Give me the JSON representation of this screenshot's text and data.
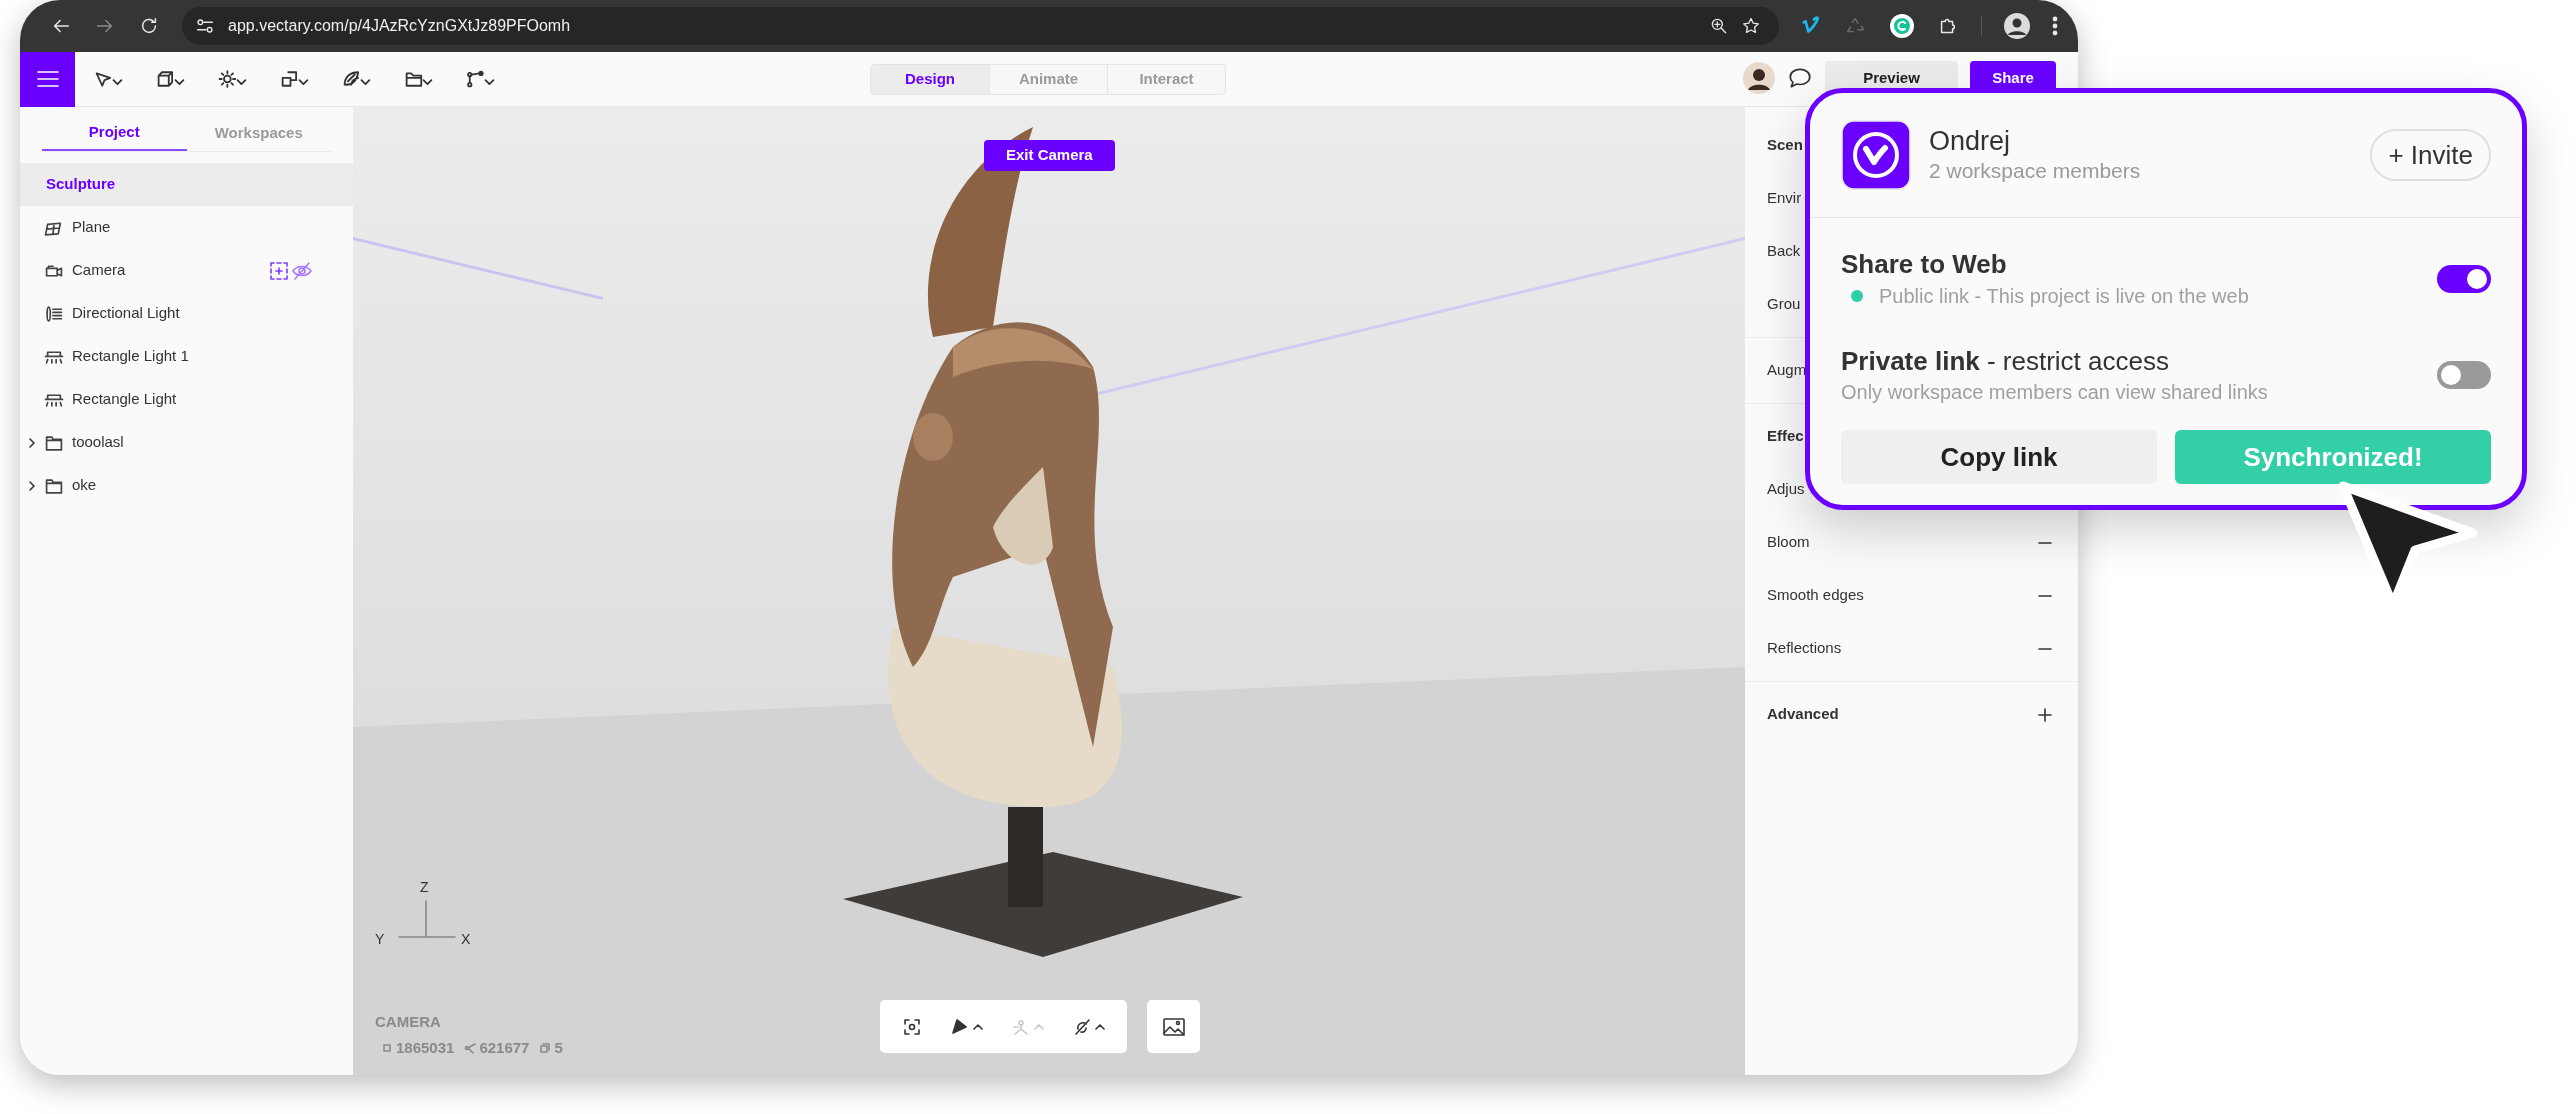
{
  "browser": {
    "url": "app.vectary.com/p/4JAzRcYznGXtJz89PFOomh"
  },
  "mode_tabs": [
    {
      "label": "Design",
      "selected": true
    },
    {
      "label": "Animate",
      "selected": false
    },
    {
      "label": "Interact",
      "selected": false
    }
  ],
  "header_buttons": [
    {
      "label": "Preview",
      "kind": "secondary"
    },
    {
      "label": "Share",
      "kind": "primary"
    }
  ],
  "sidebar": {
    "tabs": [
      {
        "label": "Project",
        "selected": true
      },
      {
        "label": "Workspaces",
        "selected": false
      }
    ],
    "items": [
      {
        "label": "Sculpture",
        "kind": "root",
        "selected": true
      },
      {
        "label": "Plane",
        "kind": "plane",
        "selected": false
      },
      {
        "label": "Camera",
        "kind": "camera",
        "selected": false
      },
      {
        "label": "Directional Light",
        "kind": "directional",
        "selected": false
      },
      {
        "label": "Rectangle Light 1",
        "kind": "rect_light",
        "selected": false
      },
      {
        "label": "Rectangle Light",
        "kind": "rect_light",
        "selected": false
      },
      {
        "label": "tooolasl",
        "kind": "folder",
        "selected": false,
        "expanded": false
      },
      {
        "label": "oke",
        "kind": "folder",
        "selected": false,
        "expanded": false
      }
    ]
  },
  "viewport": {
    "exit_button": "Exit Camera",
    "axes": {
      "z": "Z",
      "y": "Y",
      "x": "X"
    },
    "camera_label": "CAMERA",
    "stats": [
      "1865031",
      "621677",
      "5"
    ],
    "tools": [
      {
        "disabled": false
      },
      {
        "disabled": false
      },
      {
        "disabled": true
      },
      {
        "disabled": false
      }
    ]
  },
  "right_panel": {
    "sections": [
      {
        "title": "Scen",
        "rows": [
          {
            "label": "Envir"
          },
          {
            "label": "Back"
          },
          {
            "label": "Grou"
          }
        ]
      },
      {
        "rows": [
          {
            "label": "Augm"
          }
        ]
      },
      {
        "title": "Effec",
        "rows": [
          {
            "label": "Adjus"
          },
          {
            "label": "Bloom",
            "expanded": true
          },
          {
            "label": "Smooth edges",
            "expanded": true
          },
          {
            "label": "Reflections",
            "expanded": true
          }
        ]
      },
      {
        "title": "Advanced",
        "expanded": false
      }
    ]
  },
  "share_popup": {
    "workspace": "Ondrej",
    "members": "2 workspace members",
    "invite": "+ Invite",
    "options": [
      {
        "title": "Share to Web",
        "status": "Public link - This project is live on the web",
        "on": true
      },
      {
        "title": "Private link",
        "qualifier": "- restrict access",
        "description": "Only workspace members can view shared links",
        "on": false
      }
    ],
    "buttons": [
      {
        "label": "Copy link",
        "kind": "secondary"
      },
      {
        "label": "Synchronized!",
        "kind": "success"
      }
    ]
  }
}
